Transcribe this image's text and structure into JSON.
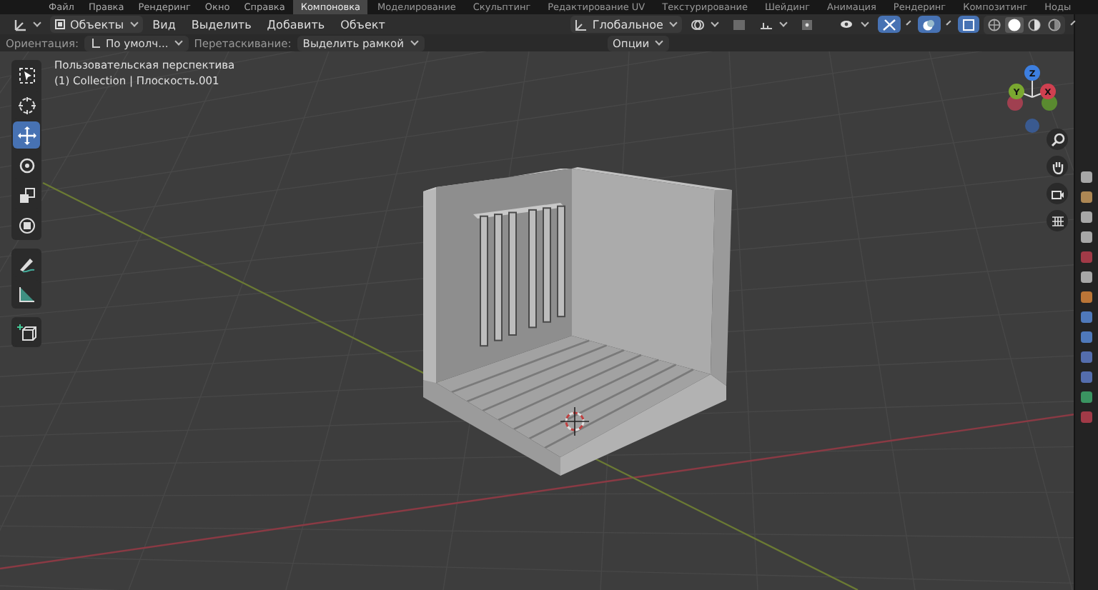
{
  "top_bar": {
    "menus": [
      "Файл",
      "Правка",
      "Рендеринг",
      "Окно",
      "Справка"
    ],
    "workspaces": [
      {
        "label": "Компоновка",
        "selected": true
      },
      {
        "label": "Моделирование",
        "selected": false
      },
      {
        "label": "Скульптинг",
        "selected": false
      },
      {
        "label": "Редактирование UV",
        "selected": false
      },
      {
        "label": "Текстурирование",
        "selected": false
      },
      {
        "label": "Шейдинг",
        "selected": false
      },
      {
        "label": "Анимация",
        "selected": false
      },
      {
        "label": "Рендеринг",
        "selected": false
      },
      {
        "label": "Композитинг",
        "selected": false
      },
      {
        "label": "Ноды",
        "selected": false
      }
    ]
  },
  "header": {
    "mode": "Объекты",
    "menus": [
      "Вид",
      "Выделить",
      "Добавить",
      "Объект"
    ],
    "orientation": "Глобальное",
    "overlays_on": true,
    "xray_on": true,
    "shading_modes": [
      {
        "selected": false
      },
      {
        "selected": true
      },
      {
        "selected": false
      },
      {
        "selected": false
      }
    ]
  },
  "tool_header": {
    "orientation_label": "Ориентация:",
    "orientation_value": "По умолч...",
    "drag_label": "Перетаскивание:",
    "drag_value": "Выделить рамкой",
    "options": "Опции"
  },
  "viewport": {
    "view_name": "Пользовательская перспектива",
    "object_info": "(1) Collection | Плоскость.001",
    "toolbar": [
      [
        {
          "kind": "select",
          "selected": false
        },
        {
          "kind": "cursor",
          "selected": false
        },
        {
          "kind": "move",
          "selected": true
        },
        {
          "kind": "rotate",
          "selected": false
        },
        {
          "kind": "scale",
          "selected": false
        },
        {
          "kind": "transform",
          "selected": false
        }
      ],
      [
        {
          "kind": "annotate",
          "selected": false
        },
        {
          "kind": "measure",
          "selected": false
        }
      ],
      [
        {
          "kind": "add-cube",
          "selected": false
        }
      ]
    ],
    "gizmo_axes": [
      "Z",
      "Y",
      "X"
    ]
  }
}
